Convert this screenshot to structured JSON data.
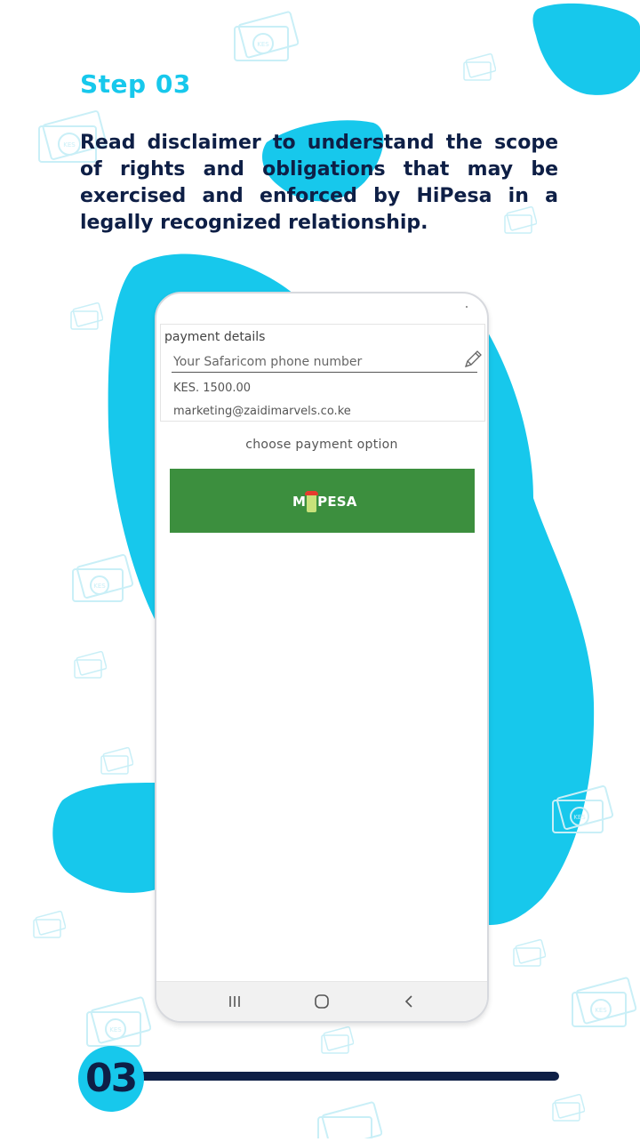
{
  "step": {
    "title": "Step 03",
    "description": "Read disclaimer to understand the scope of rights and obligations that may be exercised and enforced by HiPesa in a legally recognized relationship."
  },
  "payment": {
    "section_title": "payment details",
    "phone_placeholder": "Your Safaricom phone number",
    "amount": "KES. 1500.00",
    "email": "marketing@zaidimarvels.co.ke",
    "choose_label": "choose payment option",
    "mpesa_left": "M",
    "mpesa_right": "PESA"
  },
  "watermark": {
    "currency": "KES"
  },
  "footer": {
    "step_number": "03"
  },
  "colors": {
    "accent_cyan": "#17c8ec",
    "navy": "#0e1f46",
    "mpesa_green": "#3c8f3e"
  }
}
